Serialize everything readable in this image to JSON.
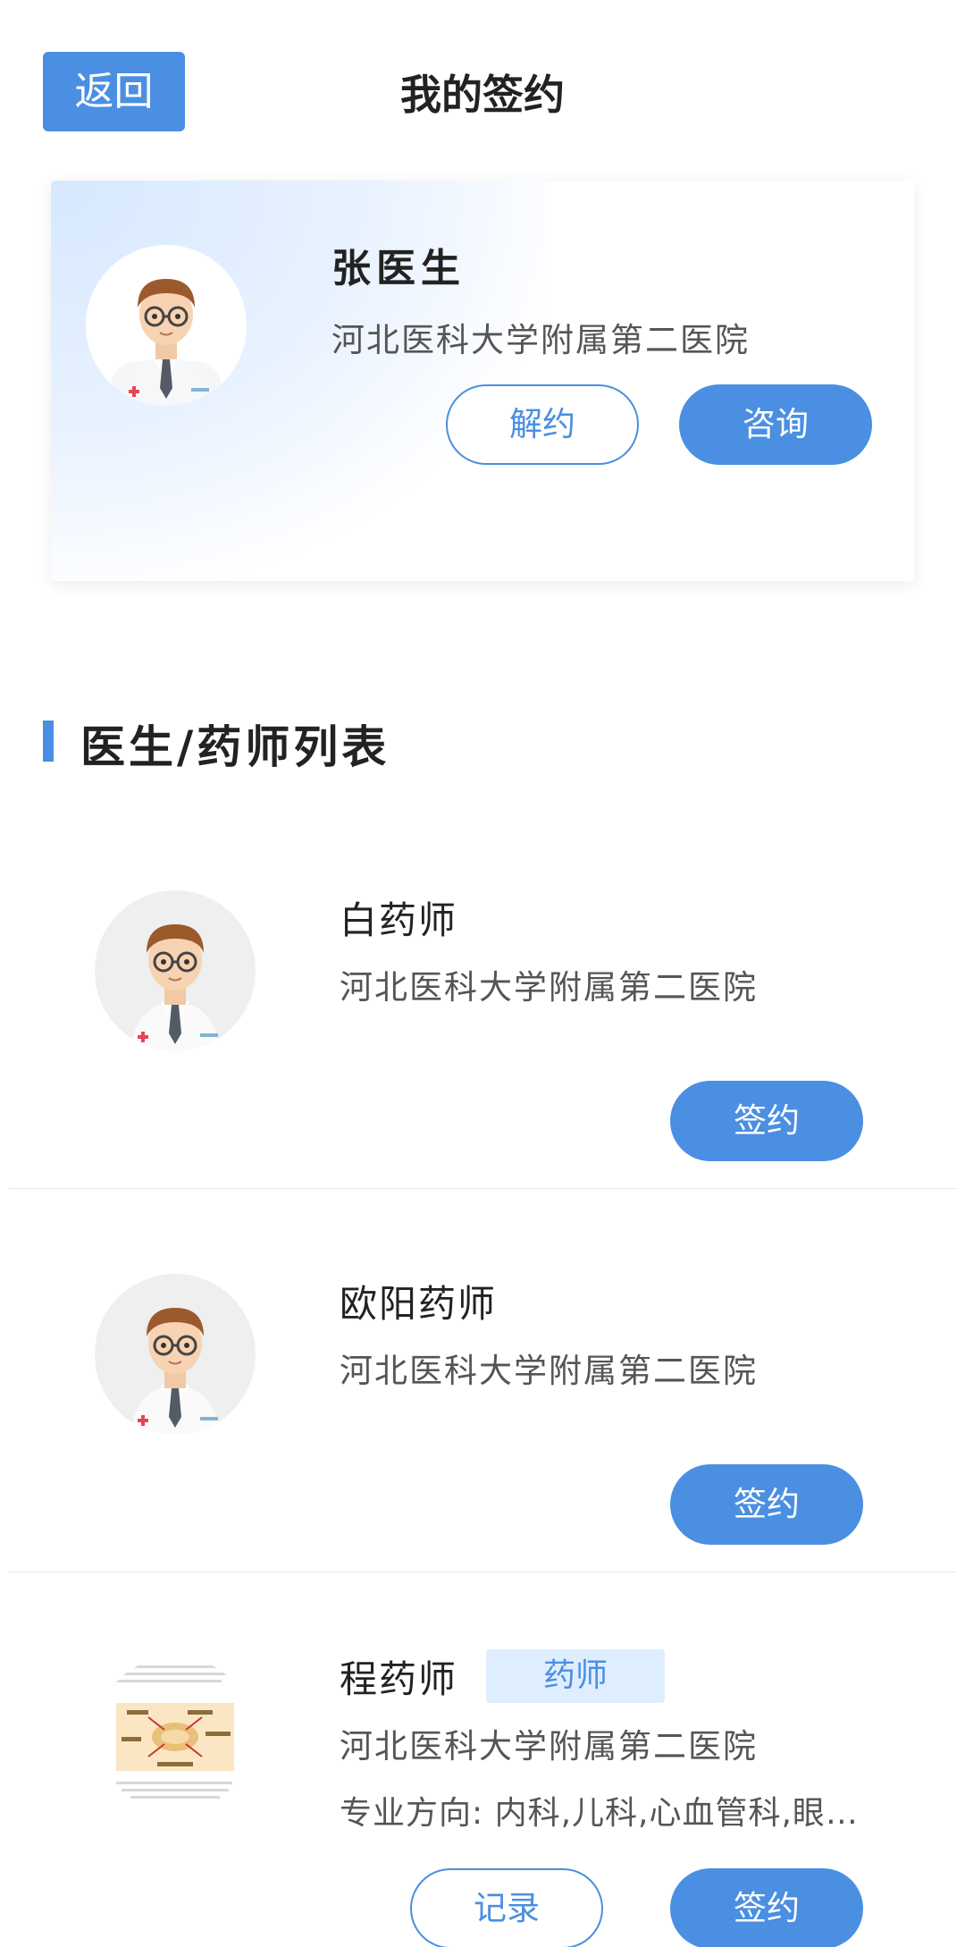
{
  "header": {
    "back_label": "返回",
    "title": "我的签约"
  },
  "signed_doctor": {
    "name": "张医生",
    "hospital": "河北医科大学附属第二医院",
    "cancel_label": "解约",
    "consult_label": "咨询"
  },
  "section": {
    "title": "医生/药师列表"
  },
  "list": [
    {
      "name": "白药师",
      "hospital": "河北医科大学附属第二医院",
      "sign_label": "签约"
    },
    {
      "name": "欧阳药师",
      "hospital": "河北医科大学附属第二医院",
      "sign_label": "签约"
    },
    {
      "name": "程药师",
      "badge": "药师",
      "hospital": "河北医科大学附属第二医院",
      "specialty": "专业方向: 内科,儿科,心血管科,眼…",
      "record_label": "记录",
      "sign_label": "签约"
    }
  ],
  "colors": {
    "accent": "#4a8fe2",
    "badge_bg": "#dfeeff"
  }
}
